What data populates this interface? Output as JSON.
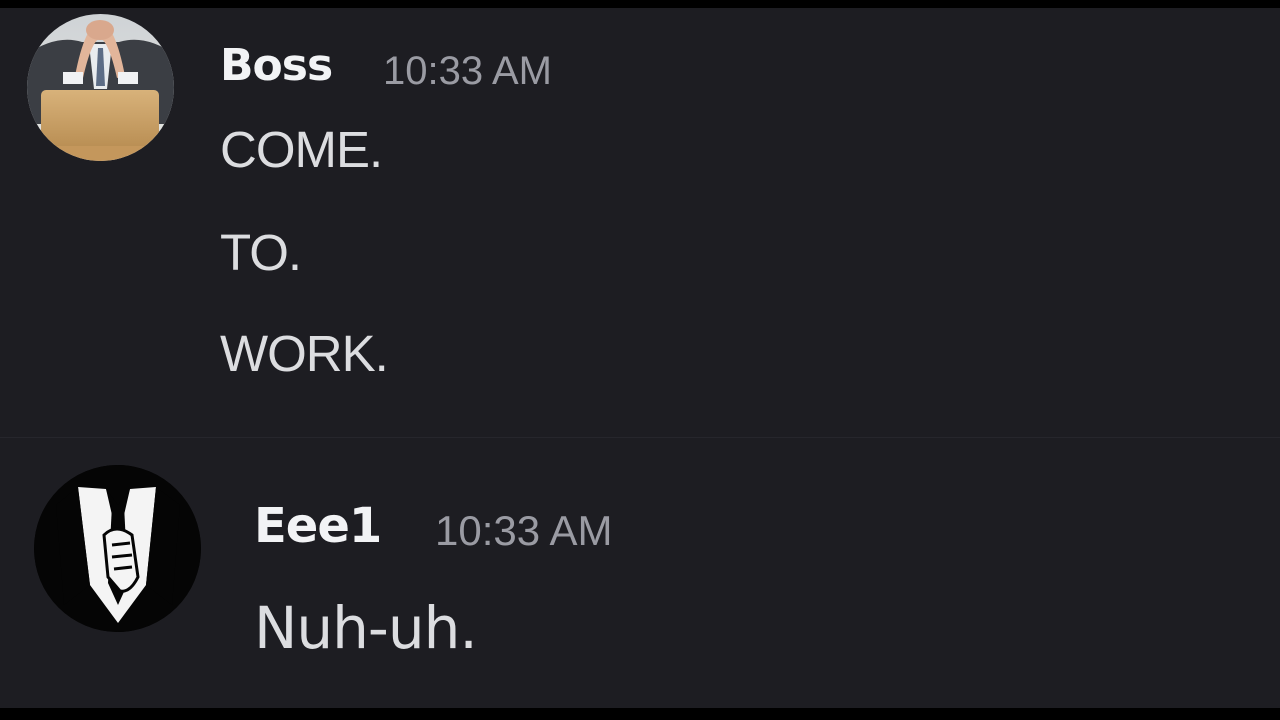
{
  "messages": [
    {
      "author": "Boss",
      "time": "10:33 AM",
      "avatar_icon": "boss-laptop-avatar",
      "lines": [
        "COME.",
        "TO.",
        "WORK."
      ]
    },
    {
      "author": "Eee1",
      "time": "10:33 AM",
      "avatar_icon": "suit-tie-avatar",
      "lines": [
        "Nuh-uh."
      ]
    }
  ],
  "colors": {
    "background": "#1d1d22",
    "username": "#f2f3f5",
    "timestamp": "#9a9ba3",
    "message_text": "#dcdde0"
  }
}
